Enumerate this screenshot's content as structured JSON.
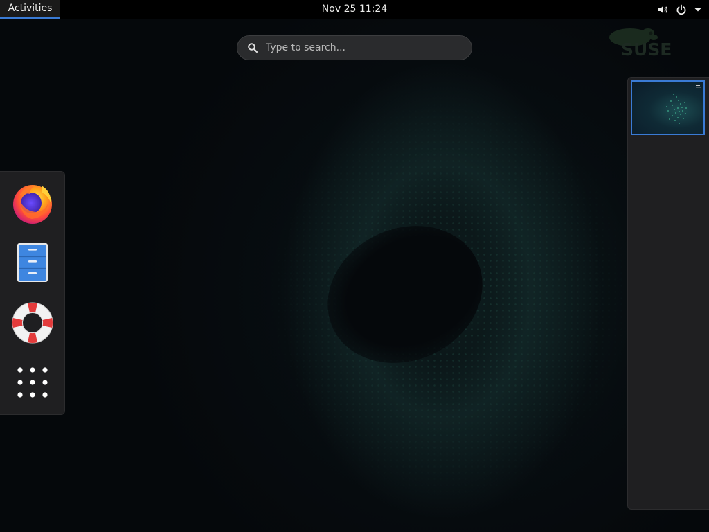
{
  "topbar": {
    "activities_label": "Activities",
    "clock": "Nov 25  11:24",
    "icons": [
      "volume-icon",
      "power-icon",
      "dropdown-arrow-icon"
    ]
  },
  "search": {
    "placeholder": "Type to search..."
  },
  "wallpaper": {
    "logo_text": "SUSE"
  },
  "dash": {
    "items": [
      {
        "name": "firefox",
        "icon": "firefox-icon"
      },
      {
        "name": "files",
        "icon": "file-cabinet-icon"
      },
      {
        "name": "help",
        "icon": "lifebuoy-icon"
      },
      {
        "name": "show-applications",
        "icon": "app-grid-icon"
      }
    ]
  },
  "workspaces": {
    "count": 1,
    "active_index": 0
  },
  "colors": {
    "accent": "#3a7bd5",
    "panel": "#1f1f21",
    "topbar": "#000000"
  }
}
